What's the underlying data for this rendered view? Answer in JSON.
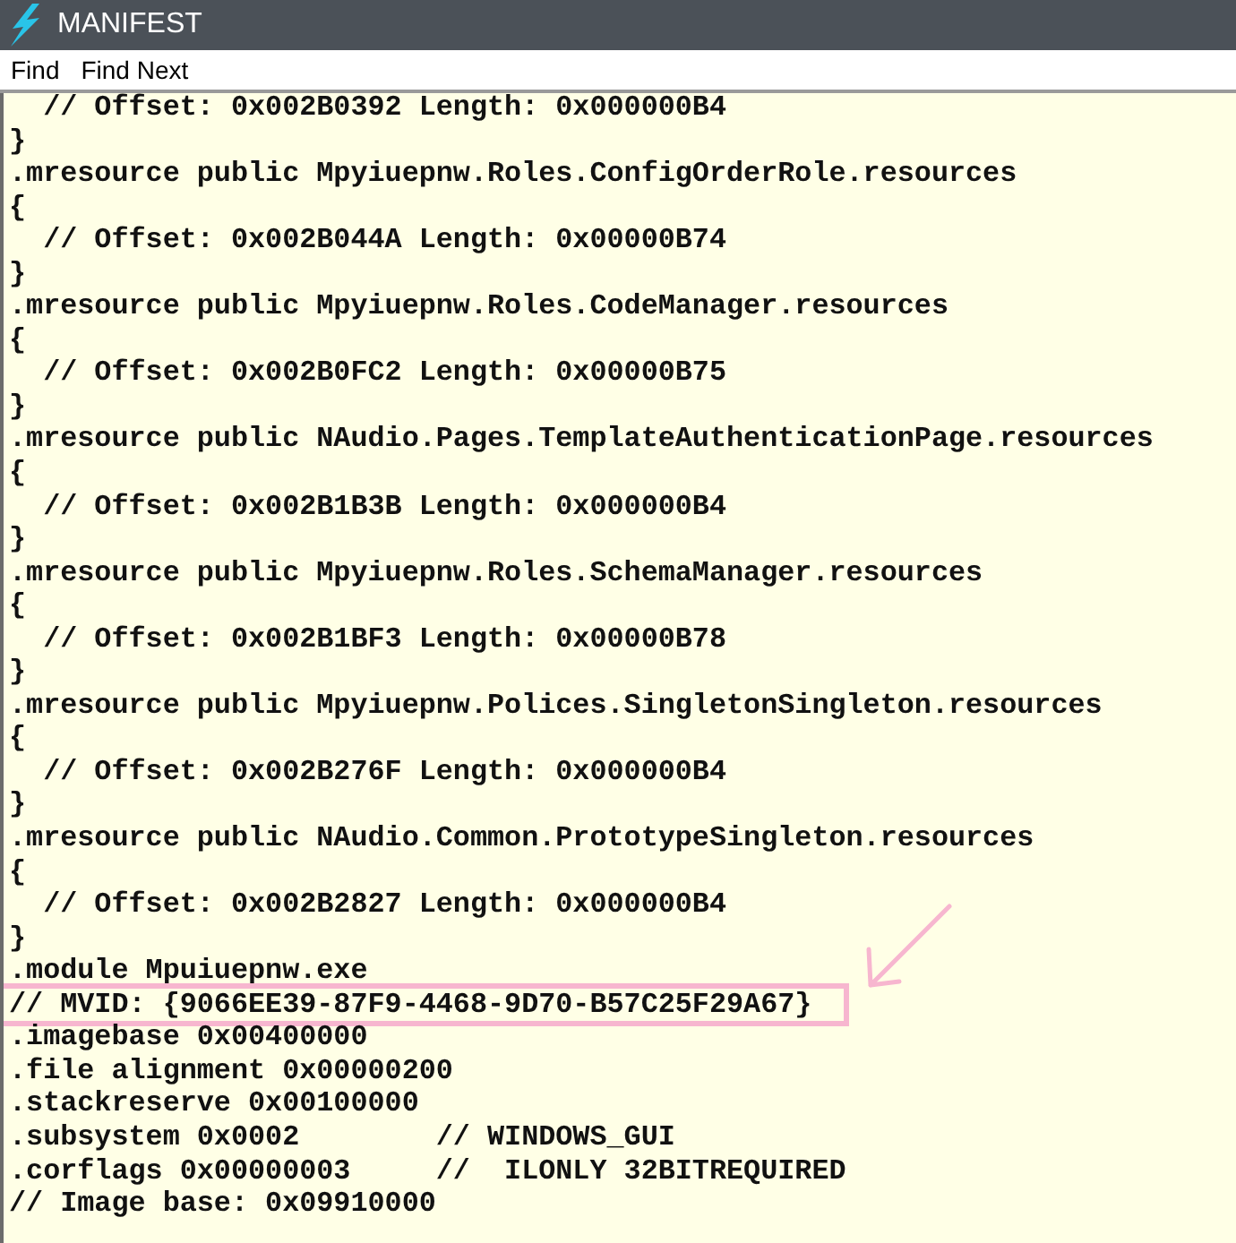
{
  "window": {
    "title": "MANIFEST"
  },
  "menu": [
    {
      "label": "Find"
    },
    {
      "label": "Find Next"
    }
  ],
  "lines": [
    {
      "text": "  // Offset: 0x002B0392 Length: 0x000000B4",
      "highlighted": false
    },
    {
      "text": "}",
      "highlighted": false
    },
    {
      "text": ".mresource public Mpyiuepnw.Roles.ConfigOrderRole.resources",
      "highlighted": false
    },
    {
      "text": "{",
      "highlighted": false
    },
    {
      "text": "  // Offset: 0x002B044A Length: 0x00000B74",
      "highlighted": false
    },
    {
      "text": "}",
      "highlighted": false
    },
    {
      "text": ".mresource public Mpyiuepnw.Roles.CodeManager.resources",
      "highlighted": false
    },
    {
      "text": "{",
      "highlighted": false
    },
    {
      "text": "  // Offset: 0x002B0FC2 Length: 0x00000B75",
      "highlighted": false
    },
    {
      "text": "}",
      "highlighted": false
    },
    {
      "text": ".mresource public NAudio.Pages.TemplateAuthenticationPage.resources",
      "highlighted": false
    },
    {
      "text": "{",
      "highlighted": false
    },
    {
      "text": "  // Offset: 0x002B1B3B Length: 0x000000B4",
      "highlighted": false
    },
    {
      "text": "}",
      "highlighted": false
    },
    {
      "text": ".mresource public Mpyiuepnw.Roles.SchemaManager.resources",
      "highlighted": false
    },
    {
      "text": "{",
      "highlighted": false
    },
    {
      "text": "  // Offset: 0x002B1BF3 Length: 0x00000B78",
      "highlighted": false
    },
    {
      "text": "}",
      "highlighted": false
    },
    {
      "text": ".mresource public Mpyiuepnw.Polices.SingletonSingleton.resources",
      "highlighted": false
    },
    {
      "text": "{",
      "highlighted": false
    },
    {
      "text": "  // Offset: 0x002B276F Length: 0x000000B4",
      "highlighted": false
    },
    {
      "text": "}",
      "highlighted": false
    },
    {
      "text": ".mresource public NAudio.Common.PrototypeSingleton.resources",
      "highlighted": false
    },
    {
      "text": "{",
      "highlighted": false
    },
    {
      "text": "  // Offset: 0x002B2827 Length: 0x000000B4",
      "highlighted": false
    },
    {
      "text": "}",
      "highlighted": false
    },
    {
      "text": ".module Mpuiuepnw.exe",
      "highlighted": false
    },
    {
      "text": "// MVID: {9066EE39-87F9-4468-9D70-B57C25F29A67}",
      "highlighted": true
    },
    {
      "text": ".imagebase 0x00400000",
      "highlighted": false
    },
    {
      "text": ".file alignment 0x00000200",
      "highlighted": false
    },
    {
      "text": ".stackreserve 0x00100000",
      "highlighted": false
    },
    {
      "text": ".subsystem 0x0002        // WINDOWS_GUI",
      "highlighted": false
    },
    {
      "text": ".corflags 0x00000003     //  ILONLY 32BITREQUIRED",
      "highlighted": false
    },
    {
      "text": "// Image base: 0x09910000",
      "highlighted": false
    }
  ]
}
